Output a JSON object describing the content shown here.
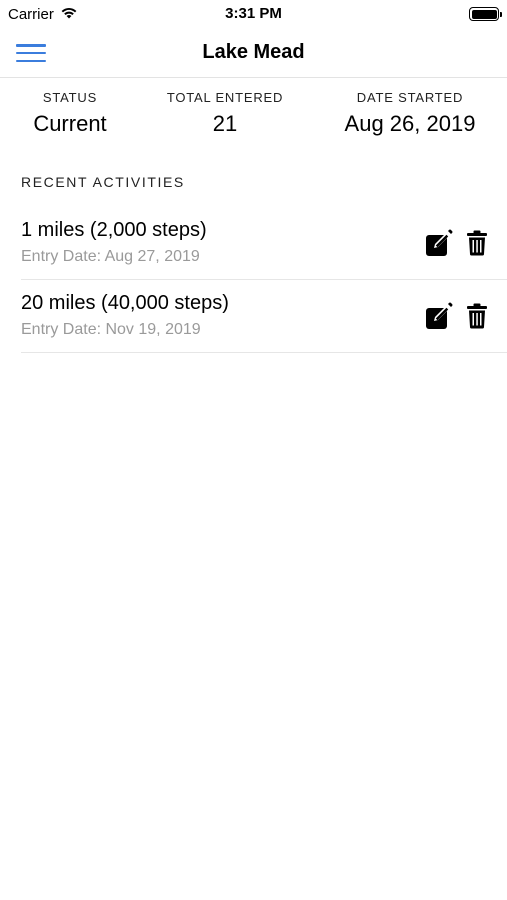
{
  "status_bar": {
    "carrier": "Carrier",
    "time": "3:31 PM",
    "battery_level": 1.0
  },
  "nav": {
    "title": "Lake Mead",
    "menu_icon": "hamburger-menu-icon",
    "accent_color": "#3b7ddd"
  },
  "stats": {
    "status": {
      "label": "STATUS",
      "value": "Current"
    },
    "total": {
      "label": "TOTAL ENTERED",
      "value": "21"
    },
    "date_started": {
      "label": "DATE STARTED",
      "value": "Aug 26, 2019"
    }
  },
  "recent": {
    "header": "RECENT ACTIVITIES",
    "items": [
      {
        "title": "1 miles (2,000 steps)",
        "date": "Entry Date: Aug 27, 2019",
        "edit_icon": "edit-icon",
        "delete_icon": "trash-icon"
      },
      {
        "title": "20 miles (40,000 steps)",
        "date": "Entry Date: Nov 19, 2019",
        "edit_icon": "edit-icon",
        "delete_icon": "trash-icon"
      }
    ]
  }
}
